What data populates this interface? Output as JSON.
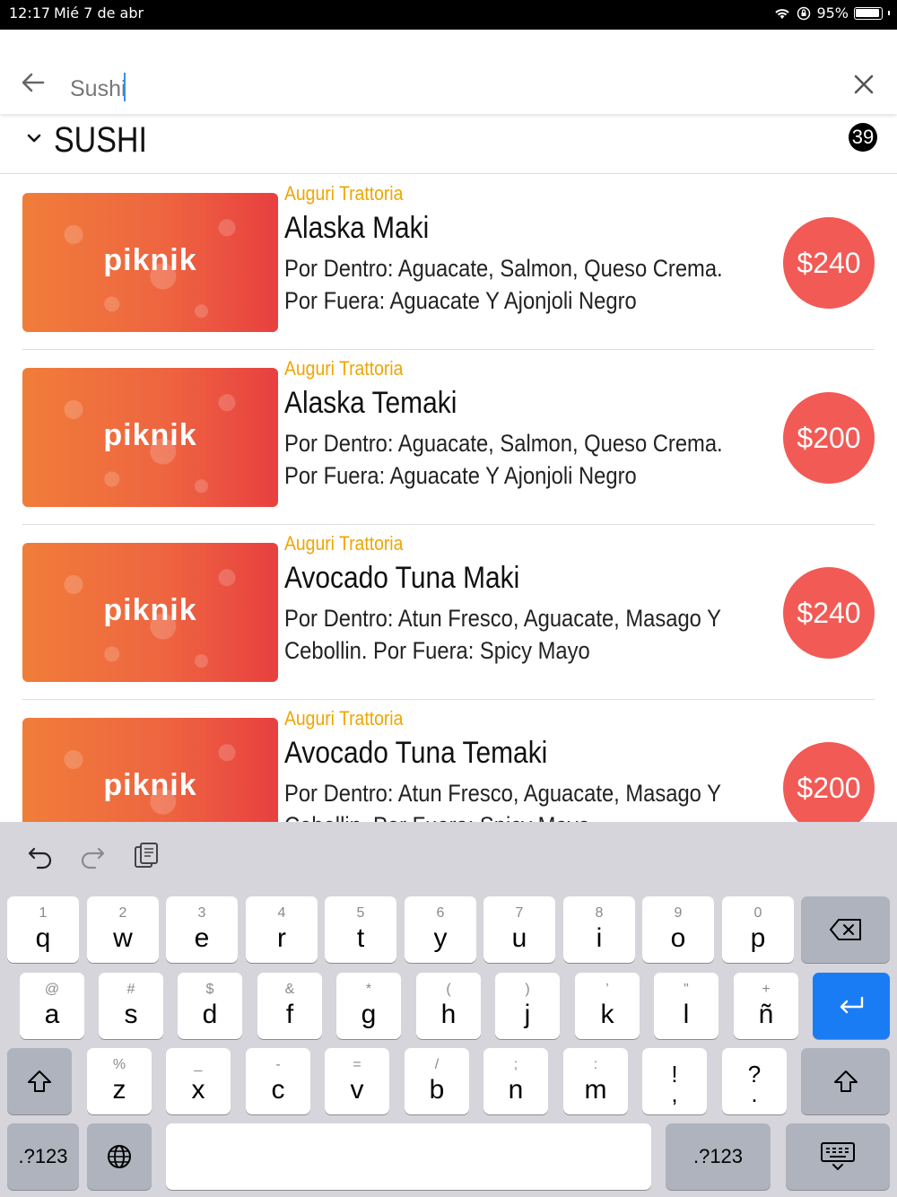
{
  "status_bar": {
    "time": "12:17",
    "date": "Mié 7 de abr",
    "battery": "95%"
  },
  "search": {
    "value": "Sushi"
  },
  "section": {
    "title": "SUSHI",
    "count": "39"
  },
  "items": [
    {
      "restaurant": "Auguri Trattoria",
      "name": "Alaska Maki",
      "description": "Por Dentro: Aguacate, Salmon, Queso Crema. Por Fuera: Aguacate Y Ajonjoli Negro",
      "price": "$240",
      "brand": "piknik"
    },
    {
      "restaurant": "Auguri Trattoria",
      "name": "Alaska Temaki",
      "description": "Por Dentro: Aguacate, Salmon, Queso Crema. Por Fuera: Aguacate Y Ajonjoli Negro",
      "price": "$200",
      "brand": "piknik"
    },
    {
      "restaurant": "Auguri Trattoria",
      "name": "Avocado Tuna Maki",
      "description": "Por Dentro: Atun Fresco, Aguacate, Masago Y Cebollin. Por Fuera: Spicy Mayo",
      "price": "$240",
      "brand": "piknik"
    },
    {
      "restaurant": "Auguri Trattoria",
      "name": "Avocado Tuna Temaki",
      "description": "Por Dentro: Atun Fresco, Aguacate, Masago Y Cebollin. Por Fuera: Spicy Mayo",
      "price": "$200",
      "brand": "piknik"
    }
  ],
  "keyboard": {
    "row1": [
      {
        "k": "q",
        "s": "1"
      },
      {
        "k": "w",
        "s": "2"
      },
      {
        "k": "e",
        "s": "3"
      },
      {
        "k": "r",
        "s": "4"
      },
      {
        "k": "t",
        "s": "5"
      },
      {
        "k": "y",
        "s": "6"
      },
      {
        "k": "u",
        "s": "7"
      },
      {
        "k": "i",
        "s": "8"
      },
      {
        "k": "o",
        "s": "9"
      },
      {
        "k": "p",
        "s": "0"
      }
    ],
    "row2": [
      {
        "k": "a",
        "s": "@"
      },
      {
        "k": "s",
        "s": "#"
      },
      {
        "k": "d",
        "s": "$"
      },
      {
        "k": "f",
        "s": "&"
      },
      {
        "k": "g",
        "s": "*"
      },
      {
        "k": "h",
        "s": "("
      },
      {
        "k": "j",
        "s": ")"
      },
      {
        "k": "k",
        "s": "’"
      },
      {
        "k": "l",
        "s": "\""
      },
      {
        "k": "ñ",
        "s": "+"
      }
    ],
    "row3": [
      {
        "k": "z",
        "s": "%"
      },
      {
        "k": "x",
        "s": "_"
      },
      {
        "k": "c",
        "s": "-"
      },
      {
        "k": "v",
        "s": "="
      },
      {
        "k": "b",
        "s": "/"
      },
      {
        "k": "n",
        "s": ";"
      },
      {
        "k": "m",
        "s": ":"
      },
      {
        "k": ",",
        "s": "!"
      },
      {
        "k": ".",
        "s": "?"
      }
    ],
    "numbers_label": ".?123"
  },
  "colors": {
    "accent_restaurant": "#f0a500",
    "price_bg": "#f25a55",
    "return_key": "#1a7cf5"
  }
}
